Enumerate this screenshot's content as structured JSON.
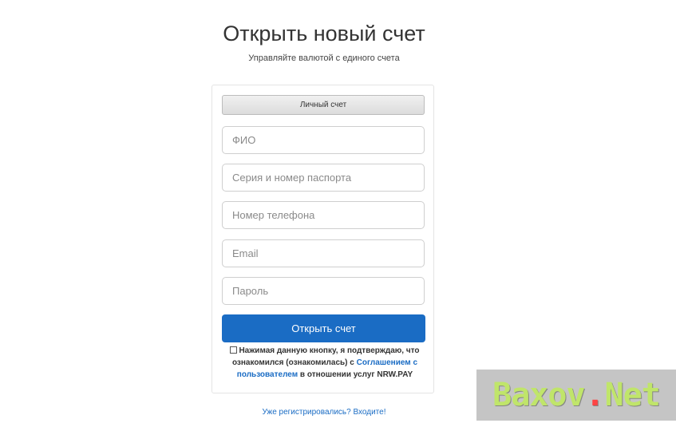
{
  "header": {
    "title": "Открыть новый счет",
    "subtitle": "Управляйте валютой с единого счета"
  },
  "form": {
    "account_type": "Личный счет",
    "fields": {
      "fio": {
        "placeholder": "ФИО",
        "value": ""
      },
      "passport": {
        "placeholder": "Серия и номер паспорта",
        "value": ""
      },
      "phone": {
        "placeholder": "Номер телефона",
        "value": ""
      },
      "email": {
        "placeholder": "Email",
        "value": ""
      },
      "password": {
        "placeholder": "Пароль",
        "value": ""
      }
    },
    "submit_label": "Открыть счет",
    "agreement": {
      "checked": false,
      "text_before": "Нажимая данную кнопку, я подтверждаю, что ознакомился (ознакомилась) с",
      "link_text": "Соглашением с пользователем",
      "text_after": "в отношении услуг NRW.PAY"
    }
  },
  "footer": {
    "login_link": "Уже регистрировались? Входите!"
  },
  "watermark": {
    "part1": "Baxov",
    "dot": ".",
    "part2": "Net"
  },
  "colors": {
    "primary": "#1a6cc4",
    "watermark_text": "#c0e56a",
    "watermark_dot": "#ff4444"
  }
}
